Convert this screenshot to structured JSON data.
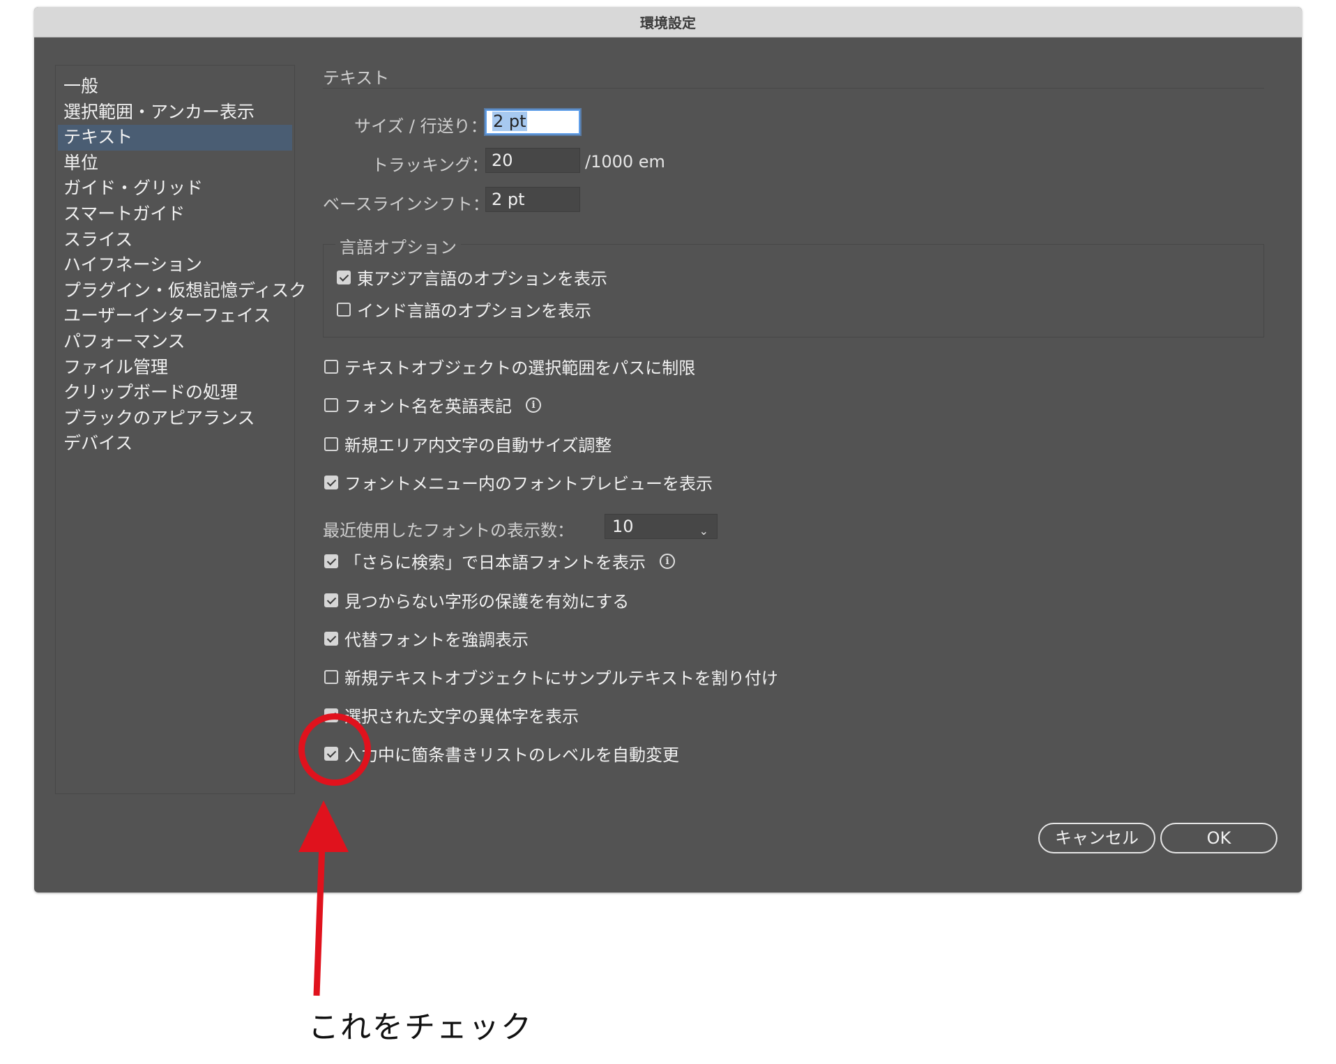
{
  "window": {
    "title": "環境設定"
  },
  "sidebar": {
    "items": [
      {
        "label": "一般"
      },
      {
        "label": "選択範囲・アンカー表示"
      },
      {
        "label": "テキスト"
      },
      {
        "label": "単位"
      },
      {
        "label": "ガイド・グリッド"
      },
      {
        "label": "スマートガイド"
      },
      {
        "label": "スライス"
      },
      {
        "label": "ハイフネーション"
      },
      {
        "label": "プラグイン・仮想記憶ディスク"
      },
      {
        "label": "ユーザーインターフェイス"
      },
      {
        "label": "パフォーマンス"
      },
      {
        "label": "ファイル管理"
      },
      {
        "label": "クリップボードの処理"
      },
      {
        "label": "ブラックのアピアランス"
      },
      {
        "label": "デバイス"
      }
    ],
    "selected_index": 2
  },
  "section": {
    "title": "テキスト"
  },
  "fields": {
    "size_leading": {
      "label": "サイズ / 行送り：",
      "value": "2 pt"
    },
    "tracking": {
      "label": "トラッキング：",
      "value": "20",
      "unit": "/1000 em"
    },
    "baseline_shift": {
      "label": "ベースラインシフト：",
      "value": "2 pt"
    }
  },
  "language_options": {
    "title": "言語オプション",
    "items": [
      {
        "label": "東アジア言語のオプションを表示",
        "checked": true
      },
      {
        "label": "インド言語のオプションを表示",
        "checked": false
      }
    ]
  },
  "options": [
    {
      "label": "テキストオブジェクトの選択範囲をパスに制限",
      "checked": false
    },
    {
      "label": "フォント名を英語表記",
      "checked": false,
      "info": true
    },
    {
      "label": "新規エリア内文字の自動サイズ調整",
      "checked": false
    },
    {
      "label": "フォントメニュー内のフォントプレビューを表示",
      "checked": true
    }
  ],
  "recent_fonts": {
    "label": "最近使用したフォントの表示数：",
    "value": "10"
  },
  "options2": [
    {
      "label": "「さらに検索」で日本語フォントを表示",
      "checked": true,
      "info": true
    },
    {
      "label": "見つからない字形の保護を有効にする",
      "checked": true
    },
    {
      "label": "代替フォントを強調表示",
      "checked": true
    },
    {
      "label": "新規テキストオブジェクトにサンプルテキストを割り付け",
      "checked": false
    },
    {
      "label": "選択された文字の異体字を表示",
      "checked": true
    },
    {
      "label": "入力中に箇条書きリストのレベルを自動変更",
      "checked": true
    }
  ],
  "buttons": {
    "cancel": "キャンセル",
    "ok": "OK"
  },
  "info_glyph": "i",
  "annotation": {
    "text": "これをチェック",
    "color": "#e0121d"
  },
  "icons": {
    "checkbox": "checkbox-icon",
    "info": "info-icon",
    "dropdown": "chevron-down-icon"
  }
}
